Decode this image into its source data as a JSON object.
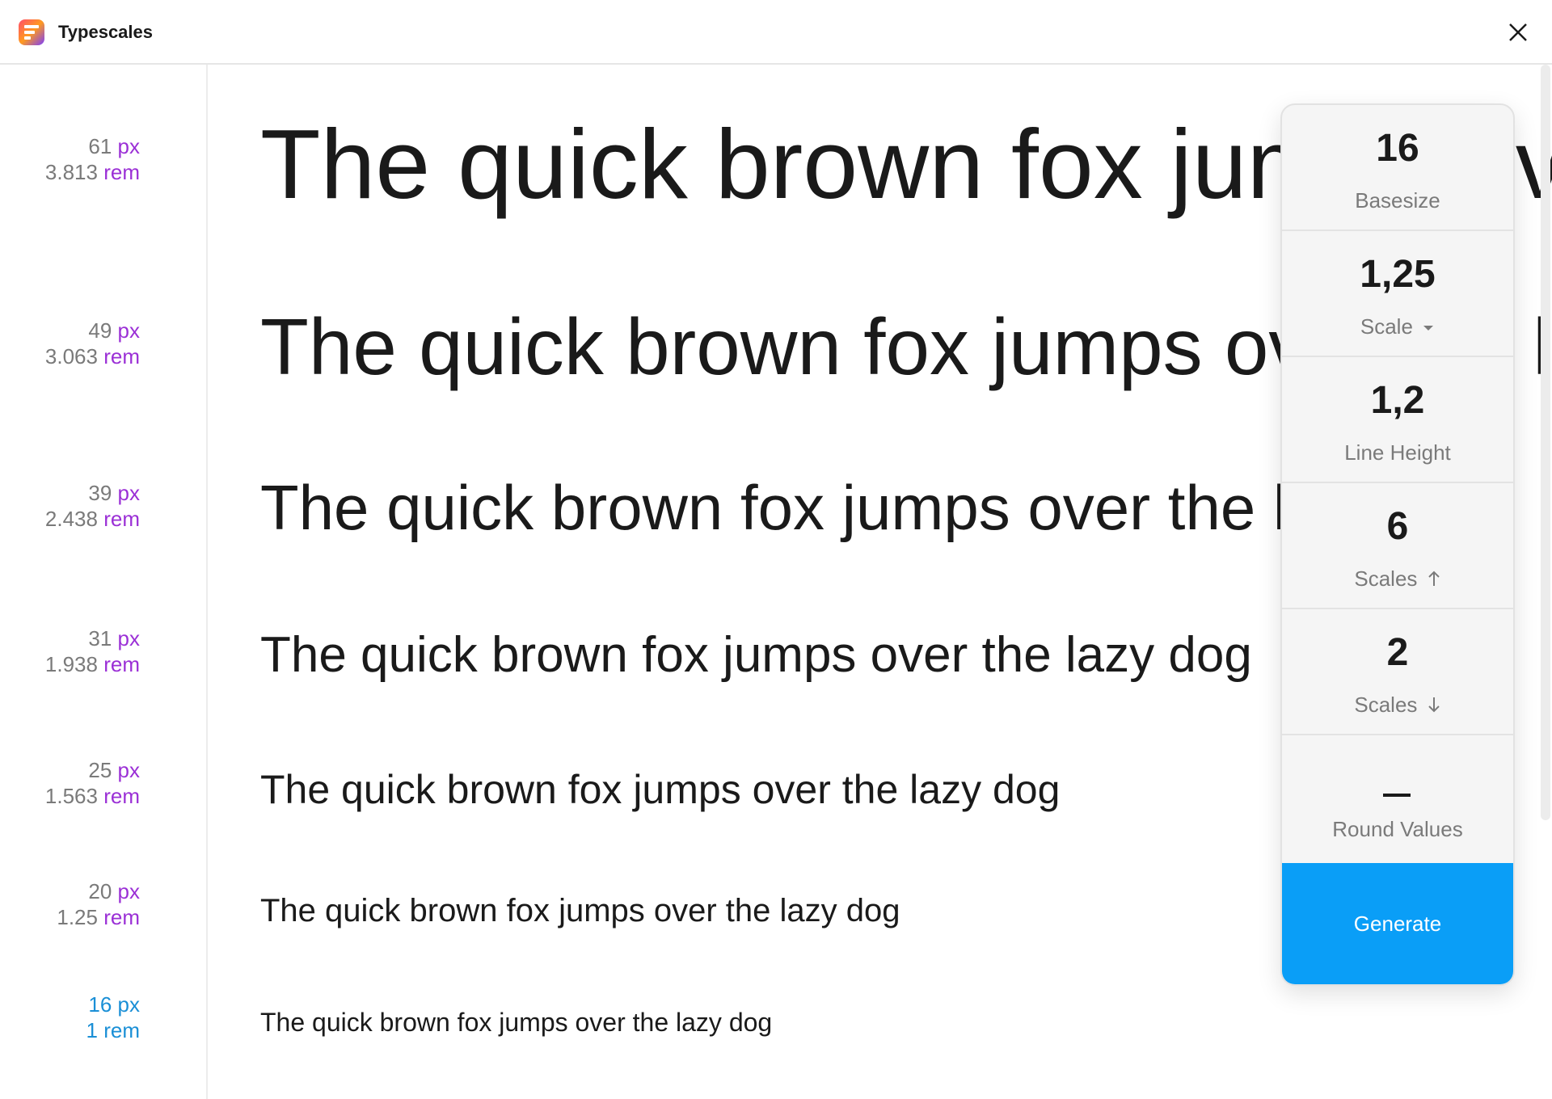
{
  "window": {
    "title": "Typescales",
    "icon": "typescales-app-icon"
  },
  "scale_rows": [
    {
      "px": "61",
      "rem": "3.813",
      "px_unit": "px",
      "rem_unit": "rem",
      "sample": "The quick brown fox jumps over the lazy dog"
    },
    {
      "px": "49",
      "rem": "3.063",
      "px_unit": "px",
      "rem_unit": "rem",
      "sample": "The quick brown fox jumps over the lazy dog"
    },
    {
      "px": "39",
      "rem": "2.438",
      "px_unit": "px",
      "rem_unit": "rem",
      "sample": "The quick brown fox jumps over the lazy dog"
    },
    {
      "px": "31",
      "rem": "1.938",
      "px_unit": "px",
      "rem_unit": "rem",
      "sample": "The quick brown fox jumps over the lazy dog"
    },
    {
      "px": "25",
      "rem": "1.563",
      "px_unit": "px",
      "rem_unit": "rem",
      "sample": "The quick brown fox jumps over the lazy dog"
    },
    {
      "px": "20",
      "rem": "1.25",
      "px_unit": "px",
      "rem_unit": "rem",
      "sample": "The quick brown fox jumps over the lazy dog"
    },
    {
      "px": "16",
      "rem": "1",
      "px_unit": "px",
      "rem_unit": "rem",
      "sample": "The quick brown fox jumps over the lazy dog"
    }
  ],
  "panel": {
    "basesize": {
      "value": "16",
      "label": "Basesize"
    },
    "scale": {
      "value": "1,25",
      "label": "Scale",
      "icon": "caret-down-icon"
    },
    "line_height": {
      "value": "1,2",
      "label": "Line Height"
    },
    "scales_up": {
      "value": "6",
      "label": "Scales",
      "icon": "arrow-up-icon"
    },
    "scales_down": {
      "value": "2",
      "label": "Scales",
      "icon": "arrow-down-icon"
    },
    "round_values": {
      "label": "Round Values",
      "state": "unchecked",
      "icon": "dash-icon"
    },
    "generate_label": "Generate"
  },
  "colors": {
    "accent": "#0a9ef7",
    "unit": "#9b30d6",
    "base": "#1a8fd6"
  }
}
